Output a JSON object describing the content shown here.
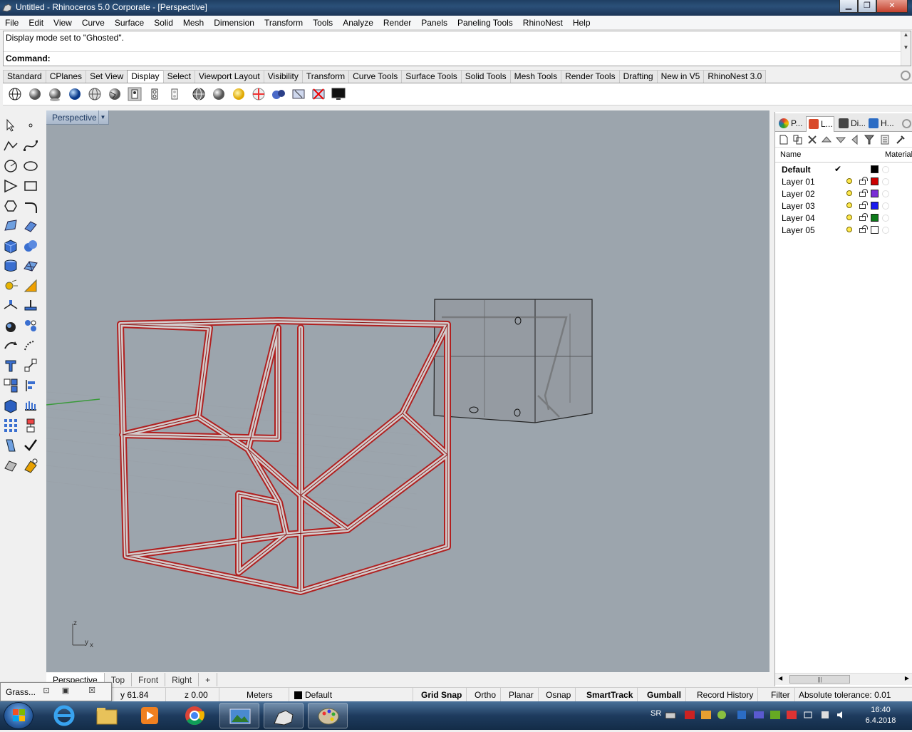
{
  "window": {
    "title": "Untitled - Rhinoceros  5.0 Corporate - [Perspective]",
    "minimize": "▁",
    "restore": "❐",
    "close": "✕"
  },
  "menu": [
    "File",
    "Edit",
    "View",
    "Curve",
    "Surface",
    "Solid",
    "Mesh",
    "Dimension",
    "Transform",
    "Tools",
    "Analyze",
    "Render",
    "Panels",
    "Paneling Tools",
    "RhinoNest",
    "Help"
  ],
  "command": {
    "history": "Display mode set to \"Ghosted\".",
    "prompt": "Command:"
  },
  "toolbar_tabs": [
    "Standard",
    "CPlanes",
    "Set View",
    "Display",
    "Select",
    "Viewport Layout",
    "Visibility",
    "Transform",
    "Curve Tools",
    "Surface Tools",
    "Solid Tools",
    "Mesh Tools",
    "Render Tools",
    "Drafting",
    "New in V5",
    "RhinoNest 3.0"
  ],
  "active_toolbar_tab": "Display",
  "display_tools": [
    "wireframe-mode-icon",
    "shaded-mode-icon",
    "rendered-mode-icon",
    "ghosted-mode-icon",
    "xray-mode-icon",
    "technical-mode-icon",
    "artistic-mode-icon",
    "pen-mode-icon",
    "ghosted-view-icon",
    "render-preview-icon",
    "sun-icon",
    "section-icon",
    "silhouette-icon",
    "zebra-icon",
    "no-shade-icon",
    "monitor-icon"
  ],
  "viewport": {
    "label": "Perspective",
    "dropdown": "▼",
    "axis_z": "z",
    "axis_y": "y",
    "axis_x": "x"
  },
  "viewport_tabs": [
    "Perspective",
    "Top",
    "Front",
    "Right"
  ],
  "viewport_tab_add": "+",
  "panel": {
    "tabs": [
      {
        "label": "P...",
        "icon": "properties-icon",
        "color": "#e23d2d"
      },
      {
        "label": "L...",
        "icon": "layers-icon",
        "color": "#d94a2a"
      },
      {
        "label": "Di...",
        "icon": "display-icon",
        "color": "#444444"
      },
      {
        "label": "H...",
        "icon": "help-icon",
        "color": "#2b6cc4"
      }
    ],
    "col_name": "Name",
    "col_material": "Material",
    "layers": [
      {
        "name": "Default",
        "current": "✔",
        "color": "#000000",
        "bold": true
      },
      {
        "name": "Layer 01",
        "current": "",
        "color": "#cc0000",
        "bold": false
      },
      {
        "name": "Layer 02",
        "current": "",
        "color": "#7a2ed6",
        "bold": false
      },
      {
        "name": "Layer 03",
        "current": "",
        "color": "#1a1aee",
        "bold": false
      },
      {
        "name": "Layer 04",
        "current": "",
        "color": "#0d7a1a",
        "bold": false
      },
      {
        "name": "Layer 05",
        "current": "",
        "color": "#ffffff",
        "bold": false
      }
    ],
    "scroll_grip": "|||"
  },
  "status": {
    "y": "y 61.84",
    "z": "z 0.00",
    "units": "Meters",
    "layer": "Default",
    "grid_snap": "Grid Snap",
    "ortho": "Ortho",
    "planar": "Planar",
    "osnap": "Osnap",
    "smarttrack": "SmartTrack",
    "gumball": "Gumball",
    "record_history": "Record History",
    "filter": "Filter",
    "tolerance": "Absolute tolerance: 0.01"
  },
  "grasshopper": {
    "label": "Grass...",
    "btn1": "⊡",
    "btn2": "▣",
    "btn3": "☒"
  },
  "taskbar": {
    "lang": "SR",
    "time": "16:40",
    "date": "6.4.2018"
  }
}
